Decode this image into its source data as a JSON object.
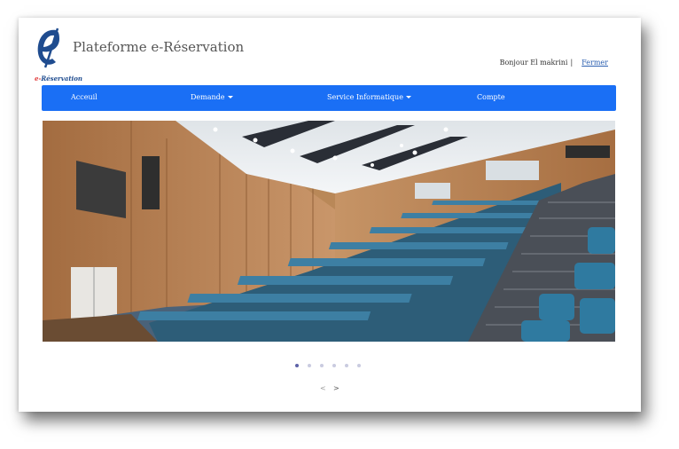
{
  "header": {
    "site_title": "Plateforme e-Réservation",
    "logo_caption_e": "e-",
    "logo_caption_rest": "Réservation",
    "greeting": "Bonjour El makrini",
    "separator": "|",
    "logout_label": "Fermer"
  },
  "nav": {
    "items": [
      {
        "label": "Acceuil",
        "dropdown": false
      },
      {
        "label": "Demande",
        "dropdown": true
      },
      {
        "label": "Service Informatique",
        "dropdown": true
      },
      {
        "label": "Compte",
        "dropdown": false
      }
    ]
  },
  "carousel": {
    "slide_count": 6,
    "active_index": 0,
    "prev_symbol": "<",
    "next_symbol": ">"
  },
  "colors": {
    "navbar": "#1a6ff5",
    "dot_active": "#5d62a8",
    "dot_inactive": "#c9cbe0",
    "logo_blue": "#1f4c8f"
  }
}
